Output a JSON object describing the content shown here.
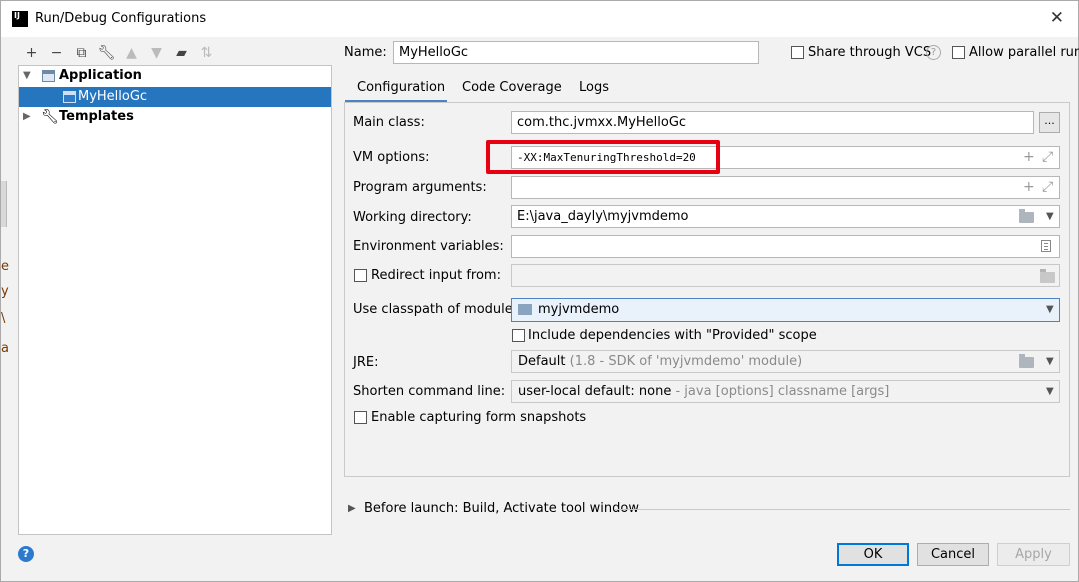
{
  "window": {
    "title": "Run/Debug Configurations",
    "app_icon": "IJ"
  },
  "toolbar": {
    "icons": [
      "plus-icon",
      "minus-icon",
      "copy-icon",
      "wrench-icon",
      "arrow-up-icon",
      "arrow-down-icon",
      "folder-add-icon",
      "sort-icon"
    ]
  },
  "tree": {
    "application": "Application",
    "config": "MyHelloGc",
    "templates": "Templates"
  },
  "header": {
    "name_label": "Name:",
    "name_value": "MyHelloGc",
    "share_label": "Share through VCS",
    "help_glyph": "?",
    "parallel_label": "Allow parallel run"
  },
  "tabs": [
    {
      "label": "Configuration",
      "active": true
    },
    {
      "label": "Code Coverage",
      "active": false
    },
    {
      "label": "Logs",
      "active": false
    }
  ],
  "form": {
    "main_class_label": "Main class:",
    "main_class_value": "com.thc.jvmxx.MyHelloGc",
    "browse_label": "...",
    "vm_options_label": "VM options:",
    "vm_options_value": "-XX:MaxTenuringThreshold=20",
    "program_args_label": "Program arguments:",
    "program_args_value": "",
    "working_dir_label": "Working directory:",
    "working_dir_value": "E:\\java_dayly\\myjvmdemo",
    "env_vars_label": "Environment variables:",
    "env_vars_value": "",
    "redirect_label": "Redirect input from:",
    "classpath_label": "Use classpath of module:",
    "classpath_value": "myjvmdemo",
    "include_deps_label": "Include dependencies with \"Provided\" scope",
    "jre_label": "JRE:",
    "jre_value": "Default",
    "jre_hint": "(1.8 - SDK of 'myjvmdemo' module)",
    "shorten_label": "Shorten command line:",
    "shorten_value": "user-local default: none",
    "shorten_hint": "- java [options] classname [args]",
    "snapshots_label": "Enable capturing form snapshots"
  },
  "before_launch": {
    "label": "Before launch: Build, Activate tool window"
  },
  "buttons": {
    "ok": "OK",
    "cancel": "Cancel",
    "apply": "Apply"
  },
  "left_edge_chars": [
    "e",
    "y",
    "\\",
    "a"
  ],
  "colors": {
    "selection": "#2675bf",
    "highlight": "#e60012",
    "primary_border": "#0078d7"
  }
}
